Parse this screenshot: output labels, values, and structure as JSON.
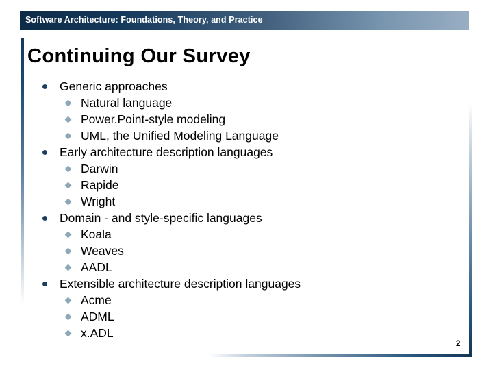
{
  "banner": {
    "text": "Software Architecture: Foundations, Theory, and Practice"
  },
  "title": "Continuing Our Survey",
  "colors": {
    "banner_dark": "#0d2b47",
    "banner_light": "#99aec3",
    "rule_navy": "#133a5c",
    "level1_bullet": "#1b3f62",
    "level2_bullet": "#8ea8b9",
    "text": "#000000",
    "background": "#ffffff"
  },
  "icons": {
    "level1_bullet": "filled-circle-bullet",
    "level2_bullet": "filled-diamond-bullet"
  },
  "content": {
    "groups": [
      {
        "heading": "Generic approaches",
        "items": [
          "Natural language",
          "Power.Point-style modeling",
          "UML, the Unified Modeling Language"
        ]
      },
      {
        "heading": "Early architecture description languages",
        "items": [
          "Darwin",
          "Rapide",
          "Wright"
        ]
      },
      {
        "heading": "Domain - and style-specific languages",
        "items": [
          "Koala",
          "Weaves",
          "AADL"
        ]
      },
      {
        "heading": "Extensible architecture description languages",
        "items": [
          "Acme",
          "ADML",
          "x.ADL"
        ]
      }
    ]
  },
  "page_number": "2"
}
